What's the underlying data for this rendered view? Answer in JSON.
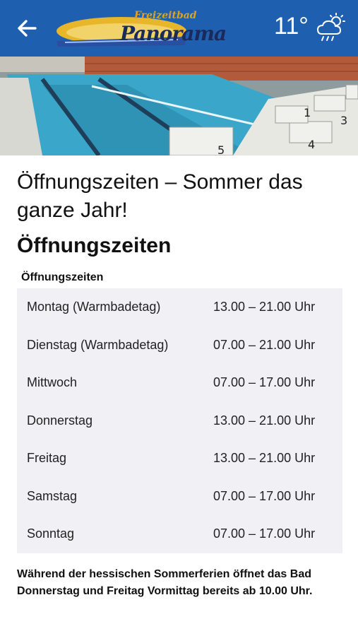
{
  "appbar": {
    "logo_top": "Freizeitbad",
    "logo_main": "Panorama",
    "temperature": "11°",
    "weather_icon": "cloud-rain-sun-icon",
    "color": "#1f5fb0"
  },
  "content": {
    "page_title": "Öffnungszeiten – Sommer das ganze Jahr!",
    "section_title": "Öffnungszeiten",
    "table_caption": "Öffnungszeiten",
    "hours": [
      {
        "day": "Montag (Warmbadetag)",
        "time": "13.00 – 21.00 Uhr"
      },
      {
        "day": "Dienstag (Warmbadetag)",
        "time": "07.00 – 21.00 Uhr"
      },
      {
        "day": "Mittwoch",
        "time": "07.00 – 17.00 Uhr"
      },
      {
        "day": "Donnerstag",
        "time": "13.00 – 21.00 Uhr"
      },
      {
        "day": "Freitag",
        "time": "13.00 – 21.00 Uhr"
      },
      {
        "day": "Samstag",
        "time": "07.00 – 17.00 Uhr"
      },
      {
        "day": "Sonntag",
        "time": "07.00 – 17.00 Uhr"
      }
    ],
    "note": "Während der hessischen Sommerferien öffnet das Bad Donnerstag und Freitag Vormittag bereits ab 10.00 Uhr."
  }
}
